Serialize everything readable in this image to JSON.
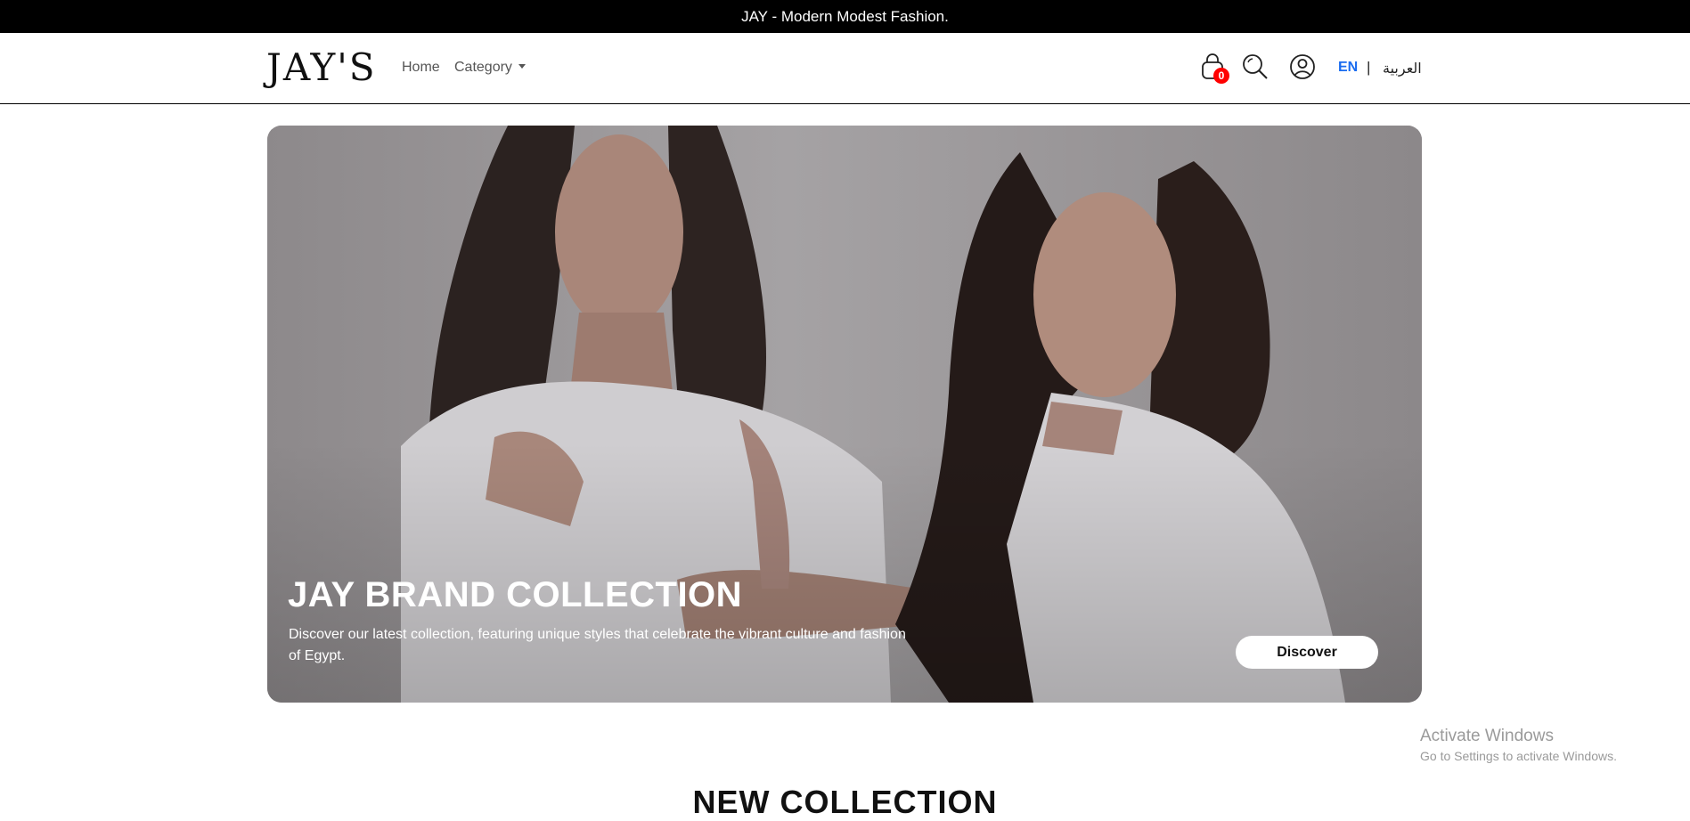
{
  "announcement": {
    "text": "JAY - Modern Modest Fashion."
  },
  "header": {
    "logo": "JAY'S",
    "nav": {
      "home": "Home",
      "category": "Category"
    },
    "cart_count": "0",
    "lang_en": "EN",
    "lang_sep": "|",
    "lang_ar": "العربية"
  },
  "hero": {
    "title": "JAY BRAND COLLECTION",
    "description": "Discover our latest collection, featuring unique styles that celebrate the vibrant culture and fashion of Egypt.",
    "button": "Discover"
  },
  "section": {
    "title": "NEW COLLECTION"
  },
  "os_watermark": {
    "title": "Activate Windows",
    "subtitle": "Go to Settings to activate Windows."
  },
  "colors": {
    "accent": "#1a6cf0",
    "badge": "#ff0000",
    "topbar": "#000000"
  },
  "icons": [
    "caret-down-icon",
    "cart-icon",
    "search-icon",
    "user-icon"
  ]
}
